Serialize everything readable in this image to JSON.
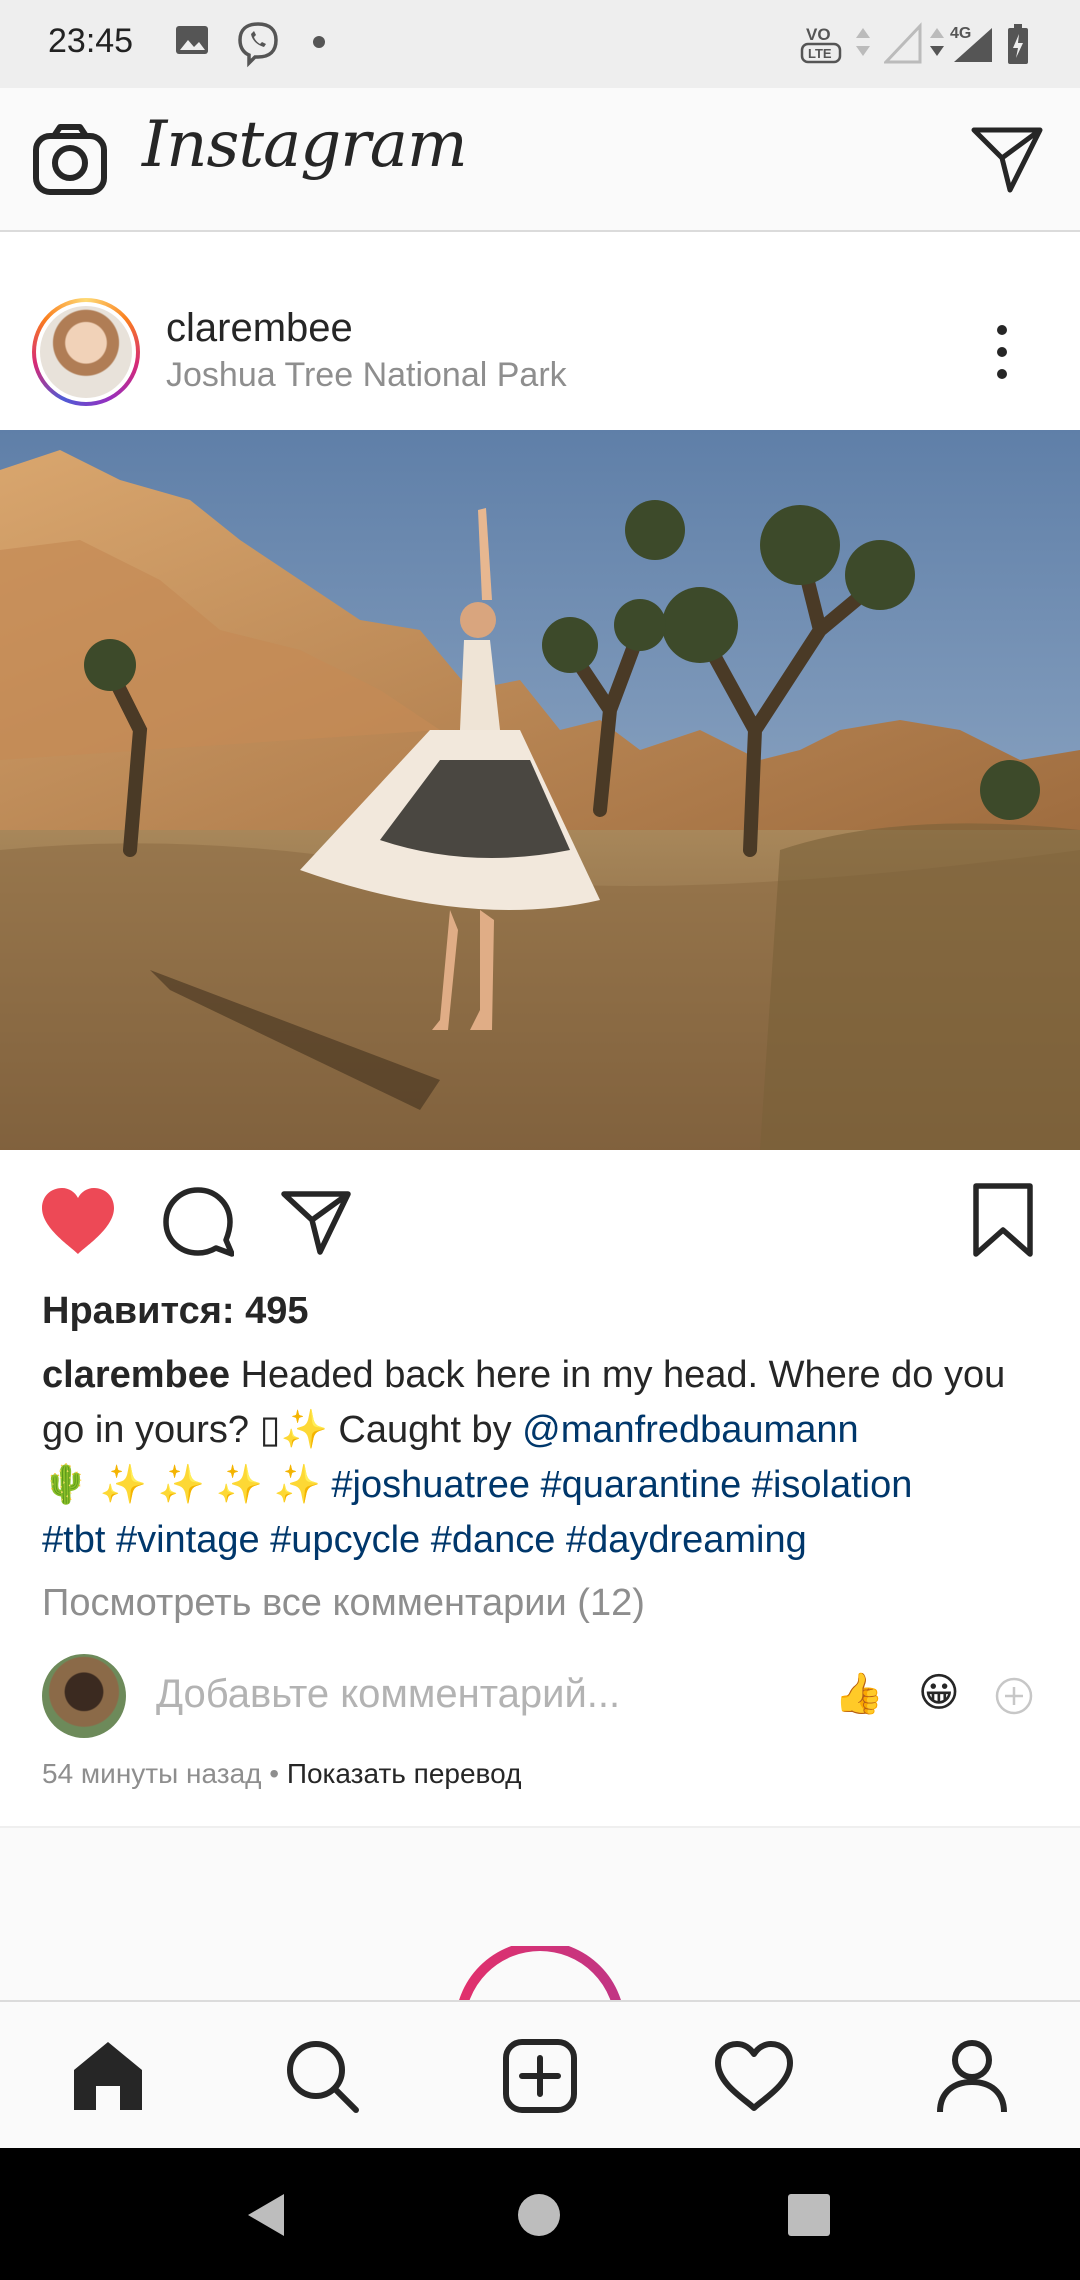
{
  "status_bar": {
    "time": "23:45",
    "network": "4G",
    "volte": "VoLTE"
  },
  "header": {
    "app_title": "Instagram"
  },
  "post": {
    "username": "clarembee",
    "location": "Joshua Tree National Park",
    "likes_text": "Нравится: 495",
    "caption": {
      "username": "clarembee",
      "text_1": " Headed back here in my head. Where do you go in yours? ",
      "glyph_box": "▯",
      "sparkle": "✨",
      "text_2": " Caught by ",
      "mention": "@manfredbaumann",
      "emoji_line": "🌵 ✨ ✨ ✨ ✨ ",
      "tags_1": "#joshuatree #quarantine #isolation",
      "tags_2": "#tbt #vintage #upcycle #dance #daydreaming"
    },
    "view_comments": "Посмотреть все комментарии (12)",
    "comment_placeholder": "Добавьте комментарий...",
    "quick_reactions": [
      "👍",
      "😀"
    ],
    "time_ago": "54 минуты назад",
    "separator": " • ",
    "translate": "Показать перевод"
  },
  "colors": {
    "like_red": "#ed4956",
    "link_blue": "#00376b",
    "muted": "#8e8e8e",
    "text": "#262626"
  },
  "icons": [
    "camera-icon",
    "direct-icon",
    "more-icon",
    "heart-filled-icon",
    "comment-icon",
    "share-icon",
    "bookmark-icon",
    "home-icon",
    "search-icon",
    "add-post-icon",
    "activity-icon",
    "profile-icon",
    "back-icon",
    "home-circle-icon",
    "recents-icon"
  ]
}
